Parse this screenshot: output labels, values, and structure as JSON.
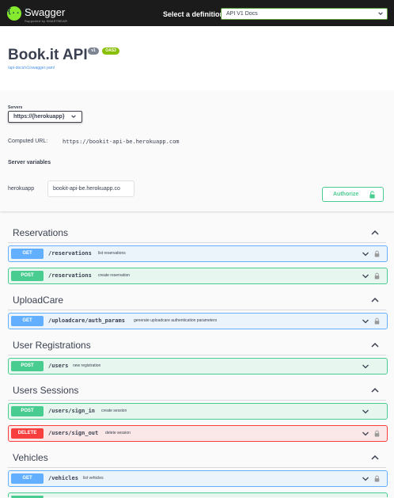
{
  "topbar": {
    "logo_glyph": "{...}",
    "brand": "Swagger",
    "brand_sub": "Supported by SMARTBEAR",
    "definition_label": "Select a definition",
    "definition_value": "API V1 Docs"
  },
  "info": {
    "title": "Book.it API",
    "version_badge": "v1",
    "oas_badge": "OAS3",
    "spec_url": "/api-docs/v1/swagger.yaml"
  },
  "servers": {
    "label": "Servers",
    "selected": "https://{herokuapp}",
    "computed_label": "Computed URL:",
    "computed_url": "https://bookit-api-be.herokuapp.com",
    "variables_title": "Server variables",
    "variable_name": "herokuapp",
    "variable_value": "bookit-api-be.herokuapp.co",
    "authorize_label": "Authorize"
  },
  "tags": [
    {
      "name": "Reservations",
      "operations": [
        {
          "method": "GET",
          "path": "/reservations",
          "summary": "list reservations"
        },
        {
          "method": "POST",
          "path": "/reservations",
          "summary": "create reservation"
        }
      ]
    },
    {
      "name": "UploadCare",
      "operations": [
        {
          "method": "GET",
          "path": "/uploadcare/auth_params",
          "summary": "generate uploadcare authentication parameters"
        }
      ]
    },
    {
      "name": "User Registrations",
      "operations": [
        {
          "method": "POST",
          "path": "/users",
          "summary": "new registration"
        }
      ]
    },
    {
      "name": "Users Sessions",
      "operations": [
        {
          "method": "POST",
          "path": "/users/sign_in",
          "summary": "create session"
        },
        {
          "method": "DELETE",
          "path": "/users/sign_out",
          "summary": "delete session"
        }
      ]
    },
    {
      "name": "Vehicles",
      "operations": [
        {
          "method": "GET",
          "path": "/vehicles",
          "summary": "list vehicles"
        }
      ]
    }
  ],
  "colors": {
    "get": "#61affe",
    "post": "#49cc90",
    "delete": "#f93e3e",
    "brand_green": "#85ea2d"
  }
}
